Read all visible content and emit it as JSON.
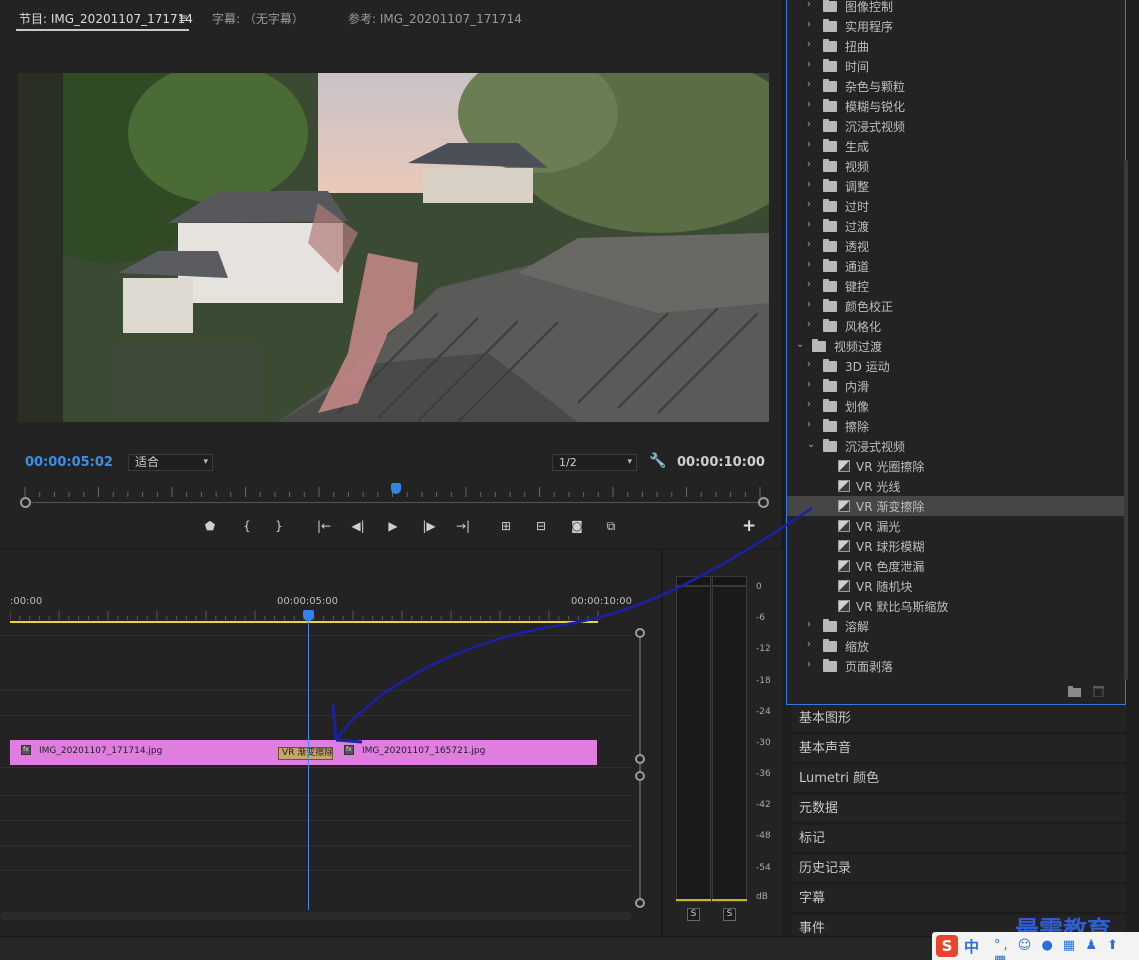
{
  "monitor": {
    "tabs": [
      {
        "label": "节目: IMG_20201107_171714",
        "active": true
      },
      {
        "label": "字幕: （无字幕）",
        "active": false
      },
      {
        "label": "参考: IMG_20201107_171714",
        "active": false
      }
    ],
    "current_timecode": "00:00:05:02",
    "fit_select": "适合",
    "resolution_select": "1/2",
    "duration_timecode": "00:00:10:00",
    "playhead_fraction": 0.5
  },
  "timeline": {
    "ruler_labels": [
      ":00:00",
      "00:00:05:00",
      "00:00:10:00"
    ],
    "clips": [
      {
        "label": "IMG_20201107_171714.jpg"
      },
      {
        "label": "IMG_20201107_165721.jpg"
      }
    ],
    "transition_label": "VR 渐变擦除"
  },
  "meter": {
    "db_labels": [
      "0",
      "-6",
      "-12",
      "-18",
      "-24",
      "-30",
      "-36",
      "-42",
      "-48",
      "-54",
      "dB"
    ],
    "solo_labels": [
      "S",
      "S"
    ]
  },
  "effects": {
    "top_partial": "图像控制",
    "video_effect_folders": [
      "实用程序",
      "扭曲",
      "时间",
      "杂色与颗粒",
      "模糊与锐化",
      "沉浸式视频",
      "生成",
      "视频",
      "调整",
      "过时",
      "过渡",
      "透视",
      "通道",
      "键控",
      "颜色校正",
      "风格化"
    ],
    "transitions_folder": "视频过渡",
    "transition_subfolders_before": [
      "3D 运动",
      "内滑",
      "划像",
      "擦除"
    ],
    "immersive_folder": "沉浸式视频",
    "immersive_items": [
      "VR 光圈擦除",
      "VR 光线",
      "VR 渐变擦除",
      "VR 漏光",
      "VR 球形模糊",
      "VR 色度泄漏",
      "VR 随机块",
      "VR 默比乌斯缩放"
    ],
    "selected_item": "VR 渐变擦除",
    "transition_subfolders_after": [
      "溶解",
      "缩放",
      "页面剥落"
    ]
  },
  "side_panels": [
    "基本图形",
    "基本声音",
    "Lumetri 颜色",
    "元数据",
    "标记",
    "历史记录",
    "字幕",
    "事件"
  ],
  "ime": {
    "logo": "S",
    "mode": "中"
  },
  "watermark": "最需教育"
}
